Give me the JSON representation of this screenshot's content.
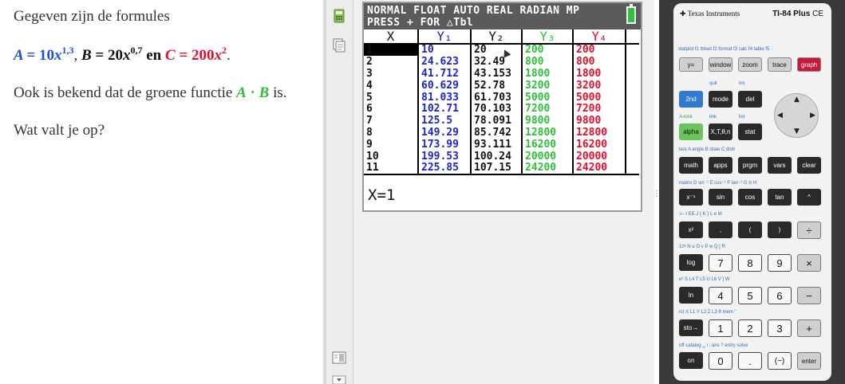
{
  "problem": {
    "line1": "Gegeven zijn de formules",
    "formulas": {
      "A": {
        "name": "A",
        "coef": "10",
        "var": "x",
        "exp": "1,3"
      },
      "B": {
        "name": "B",
        "coef": "20",
        "var": "x",
        "exp": "0,7"
      },
      "C": {
        "name": "C",
        "coef": "200",
        "var": "x",
        "exp": "2"
      },
      "eq": "=",
      "sep": ",",
      "en": "en",
      "end": "."
    },
    "line3_pre": "Ook is bekend dat de groene functie",
    "line3_expr_a": "A",
    "line3_dot": "·",
    "line3_expr_b": "B",
    "line3_post": "is.",
    "line4": "Wat valt je op?"
  },
  "screen": {
    "status_line1": "NORMAL FLOAT AUTO REAL RADIAN MP",
    "status_line2": "PRESS + FOR △Tbl",
    "columns": [
      "X",
      "Y₁",
      "Y₂",
      "Y₃",
      "Y₄"
    ],
    "rows": [
      [
        "1",
        "10",
        "20",
        "200",
        "200"
      ],
      [
        "2",
        "24.623",
        "32.49",
        "800",
        "800"
      ],
      [
        "3",
        "41.712",
        "43.153",
        "1800",
        "1800"
      ],
      [
        "4",
        "60.629",
        "52.78",
        "3200",
        "3200"
      ],
      [
        "5",
        "81.033",
        "61.703",
        "5000",
        "5000"
      ],
      [
        "6",
        "102.71",
        "70.103",
        "7200",
        "7200"
      ],
      [
        "7",
        "125.5",
        "78.091",
        "9800",
        "9800"
      ],
      [
        "8",
        "149.29",
        "85.742",
        "12800",
        "12800"
      ],
      [
        "9",
        "173.99",
        "93.111",
        "16200",
        "16200"
      ],
      [
        "10",
        "199.53",
        "100.24",
        "20000",
        "20000"
      ],
      [
        "11",
        "225.85",
        "107.15",
        "24200",
        "24200"
      ]
    ],
    "footer": "X=1"
  },
  "calculator": {
    "brand": "Texas Instruments",
    "model": "TI-84 Plus",
    "model_suffix": "CE",
    "keys": {
      "y": "y=",
      "window": "window",
      "zoom": "zoom",
      "trace": "trace",
      "graph": "graph",
      "second": "2nd",
      "mode": "mode",
      "del": "del",
      "alpha": "alpha",
      "xt": "X,T,θ,n",
      "stat": "stat",
      "math": "math",
      "apps": "apps",
      "prgm": "prgm",
      "vars": "vars",
      "clear": "clear",
      "inv": "x⁻¹",
      "sin": "sin",
      "cos": "cos",
      "tan": "tan",
      "pow": "^",
      "sq": "x²",
      "comma": ",",
      "lpar": "(",
      "rpar": ")",
      "div": "÷",
      "log": "log",
      "k7": "7",
      "k8": "8",
      "k9": "9",
      "mul": "×",
      "ln": "ln",
      "k4": "4",
      "k5": "5",
      "k6": "6",
      "sub": "−",
      "sto": "sto→",
      "k1": "1",
      "k2": "2",
      "k3": "3",
      "add": "+",
      "on": "on",
      "k0": "0",
      "dot": ".",
      "neg": "(−)",
      "enter": "enter"
    },
    "labels": {
      "row1": "statplot  f1  tblset  f2  format  f3  calc  f4  table  f5",
      "quit": "quit",
      "ins": "ins",
      "alock": "A-lock",
      "link": "link",
      "list": "list",
      "row_math": "test  A   angle  B   draw  C   distr",
      "row_inv": "matrix  D   sin⁻¹  E   cos⁻¹  F   tan⁻¹  G   π     H",
      "row_sq": "√‒    I   EE   J   {     K   }     L   e      M",
      "row_log": "10ˣ   N   u    O   v    P   w     Q   [      R",
      "row_ln": "eˣ    S   L4   T   L5   U   L6   V   ]      W",
      "row_sto": "rcl   X   L1   Y   L2   Z   L3   θ   mem    \"",
      "row_on": "off        catalog  ␣   i        :   ans    ?   entry solve"
    }
  }
}
